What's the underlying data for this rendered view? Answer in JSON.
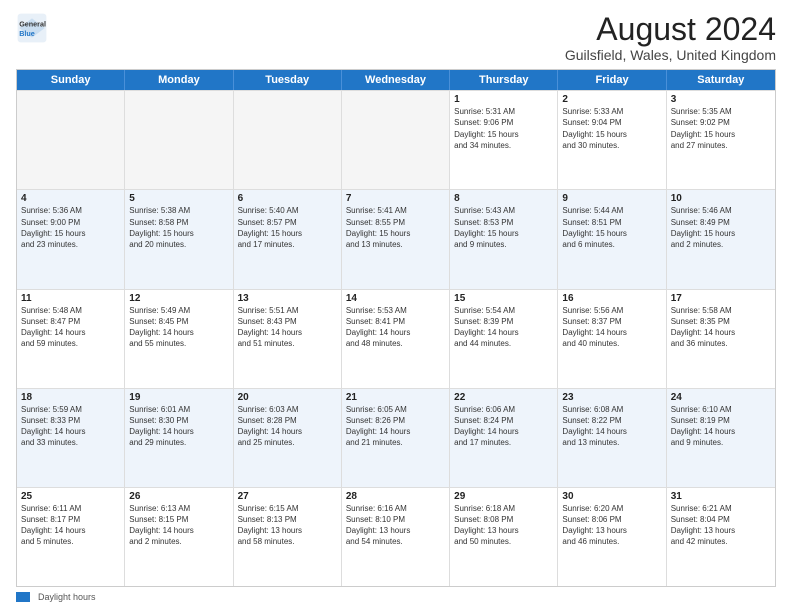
{
  "header": {
    "logo_general": "General",
    "logo_blue": "Blue",
    "main_title": "August 2024",
    "subtitle": "Guilsfield, Wales, United Kingdom"
  },
  "calendar": {
    "days_of_week": [
      "Sunday",
      "Monday",
      "Tuesday",
      "Wednesday",
      "Thursday",
      "Friday",
      "Saturday"
    ],
    "weeks": [
      [
        {
          "day": "",
          "info": ""
        },
        {
          "day": "",
          "info": ""
        },
        {
          "day": "",
          "info": ""
        },
        {
          "day": "",
          "info": ""
        },
        {
          "day": "1",
          "info": "Sunrise: 5:31 AM\nSunset: 9:06 PM\nDaylight: 15 hours\nand 34 minutes."
        },
        {
          "day": "2",
          "info": "Sunrise: 5:33 AM\nSunset: 9:04 PM\nDaylight: 15 hours\nand 30 minutes."
        },
        {
          "day": "3",
          "info": "Sunrise: 5:35 AM\nSunset: 9:02 PM\nDaylight: 15 hours\nand 27 minutes."
        }
      ],
      [
        {
          "day": "4",
          "info": "Sunrise: 5:36 AM\nSunset: 9:00 PM\nDaylight: 15 hours\nand 23 minutes."
        },
        {
          "day": "5",
          "info": "Sunrise: 5:38 AM\nSunset: 8:58 PM\nDaylight: 15 hours\nand 20 minutes."
        },
        {
          "day": "6",
          "info": "Sunrise: 5:40 AM\nSunset: 8:57 PM\nDaylight: 15 hours\nand 17 minutes."
        },
        {
          "day": "7",
          "info": "Sunrise: 5:41 AM\nSunset: 8:55 PM\nDaylight: 15 hours\nand 13 minutes."
        },
        {
          "day": "8",
          "info": "Sunrise: 5:43 AM\nSunset: 8:53 PM\nDaylight: 15 hours\nand 9 minutes."
        },
        {
          "day": "9",
          "info": "Sunrise: 5:44 AM\nSunset: 8:51 PM\nDaylight: 15 hours\nand 6 minutes."
        },
        {
          "day": "10",
          "info": "Sunrise: 5:46 AM\nSunset: 8:49 PM\nDaylight: 15 hours\nand 2 minutes."
        }
      ],
      [
        {
          "day": "11",
          "info": "Sunrise: 5:48 AM\nSunset: 8:47 PM\nDaylight: 14 hours\nand 59 minutes."
        },
        {
          "day": "12",
          "info": "Sunrise: 5:49 AM\nSunset: 8:45 PM\nDaylight: 14 hours\nand 55 minutes."
        },
        {
          "day": "13",
          "info": "Sunrise: 5:51 AM\nSunset: 8:43 PM\nDaylight: 14 hours\nand 51 minutes."
        },
        {
          "day": "14",
          "info": "Sunrise: 5:53 AM\nSunset: 8:41 PM\nDaylight: 14 hours\nand 48 minutes."
        },
        {
          "day": "15",
          "info": "Sunrise: 5:54 AM\nSunset: 8:39 PM\nDaylight: 14 hours\nand 44 minutes."
        },
        {
          "day": "16",
          "info": "Sunrise: 5:56 AM\nSunset: 8:37 PM\nDaylight: 14 hours\nand 40 minutes."
        },
        {
          "day": "17",
          "info": "Sunrise: 5:58 AM\nSunset: 8:35 PM\nDaylight: 14 hours\nand 36 minutes."
        }
      ],
      [
        {
          "day": "18",
          "info": "Sunrise: 5:59 AM\nSunset: 8:33 PM\nDaylight: 14 hours\nand 33 minutes."
        },
        {
          "day": "19",
          "info": "Sunrise: 6:01 AM\nSunset: 8:30 PM\nDaylight: 14 hours\nand 29 minutes."
        },
        {
          "day": "20",
          "info": "Sunrise: 6:03 AM\nSunset: 8:28 PM\nDaylight: 14 hours\nand 25 minutes."
        },
        {
          "day": "21",
          "info": "Sunrise: 6:05 AM\nSunset: 8:26 PM\nDaylight: 14 hours\nand 21 minutes."
        },
        {
          "day": "22",
          "info": "Sunrise: 6:06 AM\nSunset: 8:24 PM\nDaylight: 14 hours\nand 17 minutes."
        },
        {
          "day": "23",
          "info": "Sunrise: 6:08 AM\nSunset: 8:22 PM\nDaylight: 14 hours\nand 13 minutes."
        },
        {
          "day": "24",
          "info": "Sunrise: 6:10 AM\nSunset: 8:19 PM\nDaylight: 14 hours\nand 9 minutes."
        }
      ],
      [
        {
          "day": "25",
          "info": "Sunrise: 6:11 AM\nSunset: 8:17 PM\nDaylight: 14 hours\nand 5 minutes."
        },
        {
          "day": "26",
          "info": "Sunrise: 6:13 AM\nSunset: 8:15 PM\nDaylight: 14 hours\nand 2 minutes."
        },
        {
          "day": "27",
          "info": "Sunrise: 6:15 AM\nSunset: 8:13 PM\nDaylight: 13 hours\nand 58 minutes."
        },
        {
          "day": "28",
          "info": "Sunrise: 6:16 AM\nSunset: 8:10 PM\nDaylight: 13 hours\nand 54 minutes."
        },
        {
          "day": "29",
          "info": "Sunrise: 6:18 AM\nSunset: 8:08 PM\nDaylight: 13 hours\nand 50 minutes."
        },
        {
          "day": "30",
          "info": "Sunrise: 6:20 AM\nSunset: 8:06 PM\nDaylight: 13 hours\nand 46 minutes."
        },
        {
          "day": "31",
          "info": "Sunrise: 6:21 AM\nSunset: 8:04 PM\nDaylight: 13 hours\nand 42 minutes."
        }
      ]
    ]
  },
  "footer": {
    "legend_label": "Daylight hours"
  }
}
